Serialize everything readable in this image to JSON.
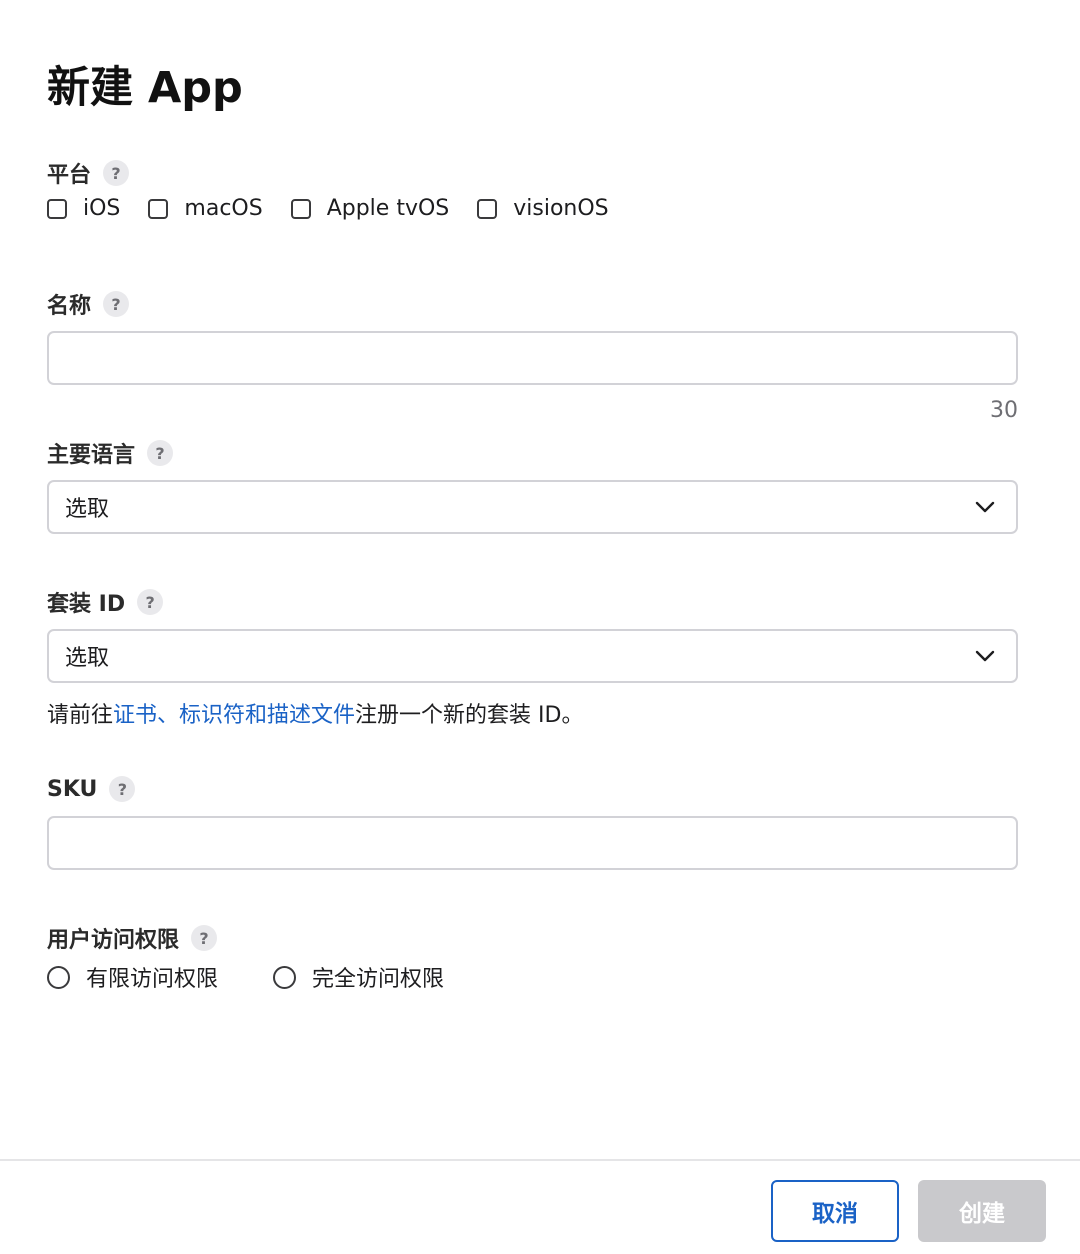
{
  "title": "新建 App",
  "help_glyph": "?",
  "platform": {
    "label": "平台",
    "options": [
      {
        "label": "iOS",
        "checked": false
      },
      {
        "label": "macOS",
        "checked": false
      },
      {
        "label": "Apple tvOS",
        "checked": false
      },
      {
        "label": "visionOS",
        "checked": false
      }
    ]
  },
  "name": {
    "label": "名称",
    "value": "",
    "char_limit": "30"
  },
  "primary_language": {
    "label": "主要语言",
    "selected": "选取"
  },
  "bundle_id": {
    "label": "套装 ID",
    "selected": "选取",
    "hint_prefix": "请前往",
    "hint_link": "证书、标识符和描述文件",
    "hint_suffix": "注册一个新的套装 ID。"
  },
  "sku": {
    "label": "SKU",
    "value": ""
  },
  "user_access": {
    "label": "用户访问权限",
    "options": [
      {
        "label": "有限访问权限",
        "selected": false
      },
      {
        "label": "完全访问权限",
        "selected": false
      }
    ]
  },
  "footer": {
    "cancel_label": "取消",
    "create_label": "创建"
  },
  "colors": {
    "accent": "#1a62c6",
    "disabled_button": "#c9c9cc",
    "border": "#d2d2d7"
  },
  "icons": {
    "help": "question-circle-icon",
    "dropdown": "chevron-down-icon"
  }
}
